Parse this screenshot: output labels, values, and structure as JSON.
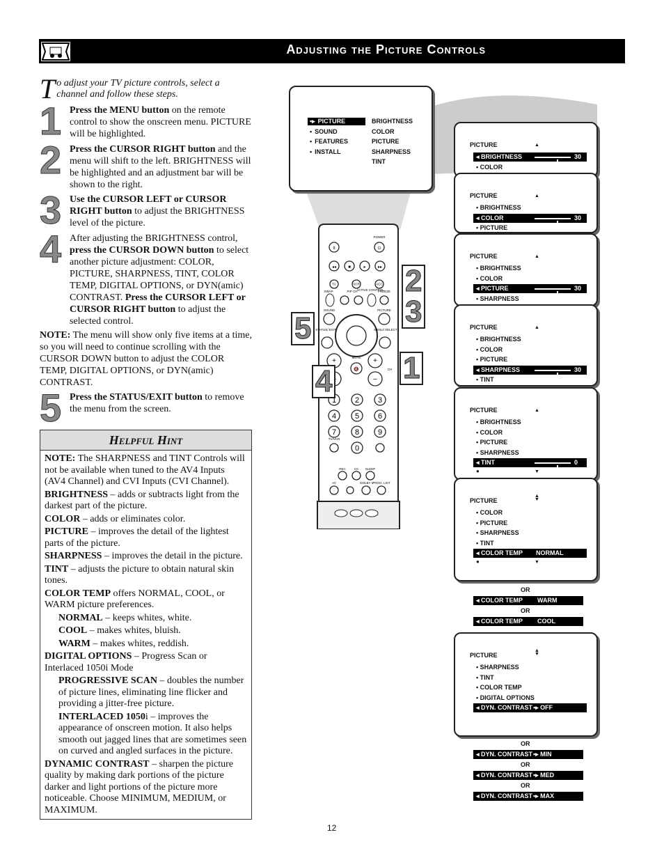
{
  "header": {
    "title": "Adjusting the Picture Controls",
    "icon": "tv-car-icon"
  },
  "intro": {
    "dropcap": "T",
    "text": "o adjust your TV picture controls, select a channel and follow these steps."
  },
  "steps": [
    {
      "num": "1",
      "bold": "Press the MENU button",
      "rest": " on the remote control to show the onscreen menu. PICTURE will be highlighted."
    },
    {
      "num": "2",
      "bold": "Press the CURSOR RIGHT button",
      "rest": " and the menu will shift to the left. BRIGHTNESS will be highlighted and an adjustment bar will be shown to the right."
    },
    {
      "num": "3",
      "bold": "Use the CURSOR LEFT or CURSOR RIGHT button",
      "rest": " to adjust the BRIGHTNESS level of the picture."
    },
    {
      "num": "4",
      "pre": "After adjusting the BRIGHTNESS control, ",
      "bold": "press the CURSOR DOWN button",
      "rest": " to select another picture adjustment: COLOR, PICTURE, SHARPNESS, TINT, COLOR TEMP, DIGITAL OPTIONS, or DYN(amic) CONTRAST. ",
      "bold2": "Press the CURSOR LEFT or CURSOR RIGHT button",
      "rest2": " to adjust the selected control."
    },
    {
      "num": "5",
      "bold": "Press the STATUS/EXIT button",
      "rest": " to remove the menu from the screen."
    }
  ],
  "note": {
    "label": "NOTE:",
    "text": " The menu will show only five items at a time, so you will need to continue scrolling with the CURSOR DOWN button to adjust the COLOR TEMP, DIGITAL OPTIONS, or DYN(amic) CONTRAST."
  },
  "hint": {
    "title": "Helpful Hint",
    "paras": [
      {
        "b": "NOTE:",
        "t": " The SHARPNESS and TINT Controls will not be available when tuned to the AV4 Inputs (AV4 Channel) and CVI Inputs (CVI Channel).",
        "ind": false
      },
      {
        "b": "BRIGHTNESS",
        "t": " – adds or subtracts light from the darkest part of the picture.",
        "ind": false
      },
      {
        "b": "COLOR",
        "t": " – adds or eliminates color.",
        "ind": false
      },
      {
        "b": "PICTURE",
        "t": " – improves the detail of the lightest parts of the picture.",
        "ind": false
      },
      {
        "b": "SHARPNESS",
        "t": " – improves the detail in the picture.",
        "ind": false
      },
      {
        "b": "TINT",
        "t": " – adjusts the picture to obtain natural skin tones.",
        "ind": false
      },
      {
        "b": "COLOR TEMP",
        "t": " offers NORMAL, COOL, or WARM picture preferences.",
        "ind": false
      },
      {
        "b": "NORMAL",
        "t": " – keeps whites, white.",
        "ind": true
      },
      {
        "b": "COOL",
        "t": " – makes whites, bluish.",
        "ind": true
      },
      {
        "b": "WARM",
        "t": " – makes whites, reddish.",
        "ind": true
      },
      {
        "b": "DIGITAL OPTIONS",
        "t": " – Progress Scan or Interlaced 1050i Mode",
        "ind": false
      },
      {
        "b": "PROGRESSIVE SCAN",
        "t": " – doubles the number of picture lines, eliminating line flicker and providing a jitter-free picture.",
        "ind": true
      },
      {
        "b": "INTERLACED 1050",
        "t": "i – improves the appearance of onscreen motion. It also helps smooth out jagged lines that are sometimes seen on curved and angled surfaces in the picture.",
        "ind": true
      },
      {
        "b": "DYNAMIC CONTRAST",
        "t": " – sharpen the picture quality by making dark portions of the picture darker and light portions of the picture more noticeable. Choose MINIMUM, MEDIUM, or MAXIMUM.",
        "ind": false
      }
    ]
  },
  "main_menu": {
    "left": [
      "PICTURE",
      "SOUND",
      "FEATURES",
      "INSTALL"
    ],
    "selected": "PICTURE",
    "right": [
      "BRIGHTNESS",
      "COLOR",
      "PICTURE",
      "SHARPNESS",
      "TINT"
    ]
  },
  "panels": [
    {
      "title": "PICTURE",
      "items": [
        {
          "label": "BRIGHTNESS",
          "hl": true,
          "value": "30",
          "slider": 0.5
        },
        {
          "label": "COLOR"
        }
      ]
    },
    {
      "title": "PICTURE",
      "items": [
        {
          "label": "BRIGHTNESS"
        },
        {
          "label": "COLOR",
          "hl": true,
          "value": "30",
          "slider": 0.5
        },
        {
          "label": "PICTURE"
        }
      ]
    },
    {
      "title": "PICTURE",
      "items": [
        {
          "label": "BRIGHTNESS"
        },
        {
          "label": "COLOR"
        },
        {
          "label": "PICTURE",
          "hl": true,
          "value": "30",
          "slider": 0.5
        },
        {
          "label": "SHARPNESS"
        }
      ]
    },
    {
      "title": "PICTURE",
      "items": [
        {
          "label": "BRIGHTNESS"
        },
        {
          "label": "COLOR"
        },
        {
          "label": "PICTURE"
        },
        {
          "label": "SHARPNESS",
          "hl": true,
          "value": "30",
          "slider": 0.5
        },
        {
          "label": "TINT"
        }
      ],
      "down": true
    },
    {
      "title": "PICTURE",
      "items": [
        {
          "label": "BRIGHTNESS"
        },
        {
          "label": "COLOR"
        },
        {
          "label": "PICTURE"
        },
        {
          "label": "SHARPNESS"
        },
        {
          "label": "TINT",
          "hl": true,
          "value": "0",
          "slider": 0.5
        }
      ],
      "down": true
    },
    {
      "title": "PICTURE",
      "both": true,
      "items": [
        {
          "label": "COLOR"
        },
        {
          "label": "PICTURE"
        },
        {
          "label": "SHARPNESS"
        },
        {
          "label": "TINT"
        },
        {
          "label": "COLOR TEMP",
          "hl": true,
          "value": "NORMAL"
        }
      ],
      "down": true
    },
    {
      "title": "PICTURE",
      "both": true,
      "items": [
        {
          "label": "SHARPNESS"
        },
        {
          "label": "TINT"
        },
        {
          "label": "COLOR TEMP"
        },
        {
          "label": "DIGITAL OPTIONS"
        },
        {
          "label": "DYN. CONTRAST",
          "hl": true,
          "value": "OFF",
          "toggle": true
        }
      ]
    }
  ],
  "alternatives": [
    {
      "or": "OR",
      "label": "COLOR TEMP",
      "value": "WARM"
    },
    {
      "or": "OR",
      "label": "COLOR TEMP",
      "value": "COOL"
    },
    {
      "or": "OR",
      "label": "DYN. CONTRAST",
      "value": "MIN",
      "toggle": true
    },
    {
      "or": "OR",
      "label": "DYN. CONTRAST",
      "value": "MED",
      "toggle": true
    },
    {
      "or": "OR",
      "label": "DYN. CONTRAST",
      "value": "MAX",
      "toggle": true
    }
  ],
  "remote": {
    "labels": {
      "power": "POWER",
      "tv": "TV",
      "vcr": "VCR",
      "acc": "ACC",
      "swap": "SWAP",
      "pipch": "PIP CH",
      "dn": "DN",
      "up": "UP",
      "active": "ACTIVE CONTROL",
      "freeze": "FREEZE",
      "sound": "SOUND",
      "picture": "PICTURE",
      "status": "STATUS/ EXIT",
      "menu": "MENU/ SELECT",
      "mute": "MUTE",
      "ch": "CH",
      "tvvcr": "TV/VCR",
      "avx": "A/CH",
      "surf": "SURF",
      "rec": "REC",
      "cc": "CC",
      "sleep": "SLEEP",
      "av": "AV",
      "dolby": "DOLBY V",
      "proglist": "PROG. LIST"
    },
    "digits": [
      "1",
      "2",
      "3",
      "4",
      "5",
      "6",
      "7",
      "8",
      "9",
      "0"
    ]
  },
  "callouts": [
    "2",
    "3",
    "5",
    "4",
    "1"
  ],
  "page_number": "12"
}
